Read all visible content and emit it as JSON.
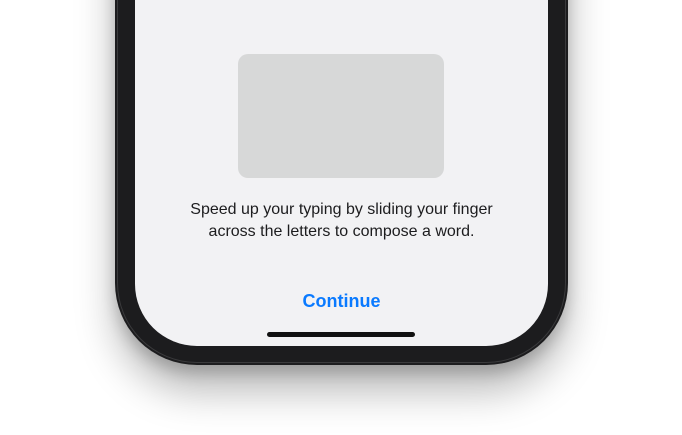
{
  "onboarding": {
    "description_line1": "Speed up your typing by sliding your finger",
    "description_line2": "across the letters to compose a word.",
    "continue_label": "Continue"
  },
  "colors": {
    "accent": "#0a7aff",
    "screen_background": "#f2f2f4",
    "placeholder": "#d7d8d8",
    "device_frame": "#1c1c1e",
    "home_indicator": "#111111"
  }
}
